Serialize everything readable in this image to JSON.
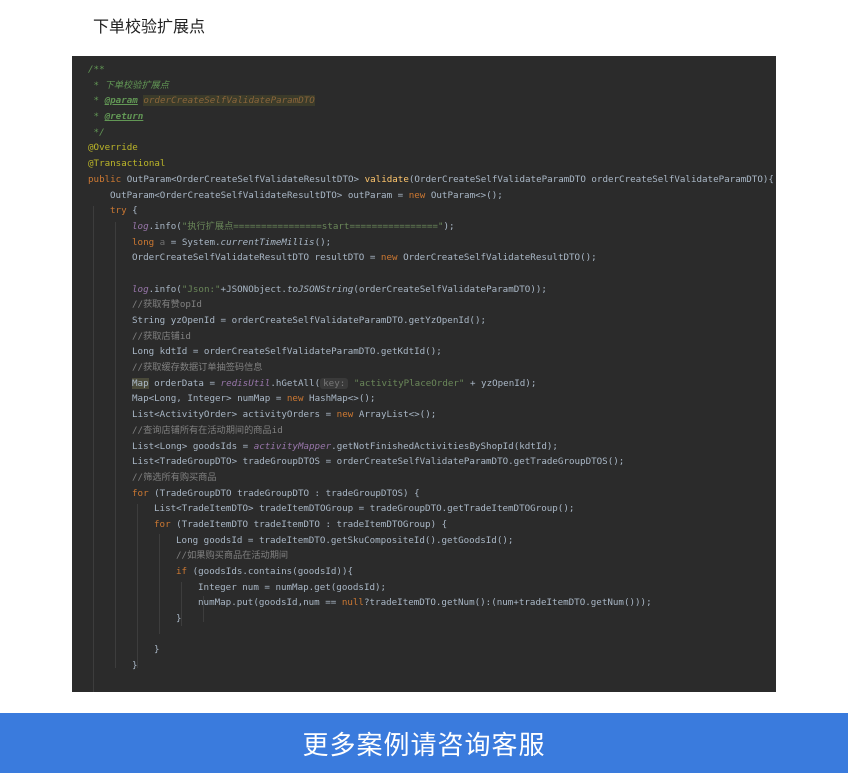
{
  "header": {
    "title": "下单校验扩展点"
  },
  "footer": {
    "text": "更多案例请咨询客服"
  },
  "colors": {
    "editor_bg": "#2b2b2b",
    "footer_bg": "#3a7bdd"
  },
  "code": {
    "l1": "/**",
    "l2": " * 下单校验扩展点",
    "l3_prefix": " * ",
    "l3_tag": "@param",
    "l3_name": "orderCreateSelfValidateParamDTO",
    "l4_prefix": " * ",
    "l4_tag": "@return",
    "l5": " */",
    "l6": "@Override",
    "l7": "@Transactional",
    "l8_kw": "public ",
    "l8_a": "OutParam<OrderCreateSelfValidateResultDTO> ",
    "l8_fn": "validate",
    "l8_b": "(OrderCreateSelfValidateParamDTO orderCreateSelfValidateParamDTO){",
    "l9_a": "OutParam<OrderCreateSelfValidateResultDTO> outParam = ",
    "l9_kw": "new ",
    "l9_b": "OutParam<>();",
    "l10_kw": "try ",
    "l10_b": "{",
    "l11_log": "log",
    "l11_a": ".info(",
    "l11_str": "\"执行扩展点================start================\"",
    "l11_b": ");",
    "l12_kw": "long ",
    "l12_var": "a",
    "l12_a": " = System.",
    "l12_it": "currentTimeMillis",
    "l12_b": "();",
    "l13_a": "OrderCreateSelfValidateResultDTO resultDTO = ",
    "l13_kw": "new ",
    "l13_b": "OrderCreateSelfValidateResultDTO();",
    "l15_log": "log",
    "l15_a": ".info(",
    "l15_str": "\"Json:\"",
    "l15_b": "+JSONObject.",
    "l15_it": "toJSONString",
    "l15_c": "(orderCreateSelfValidateParamDTO));",
    "l16": "//获取有赞opId",
    "l17": "String yzOpenId = orderCreateSelfValidateParamDTO.getYzOpenId();",
    "l18": "//获取店铺id",
    "l19": "Long kdtId = orderCreateSelfValidateParamDTO.getKdtId();",
    "l20": "//获取缓存数据订单抽签码信息",
    "l21_mark": "Map",
    "l21_a": " orderData = ",
    "l21_fld": "redisUtil",
    "l21_b": ".hGetAll(",
    "l21_hint": "key:",
    "l21_str": "\"activityPlaceOrder\"",
    "l21_c": " + yzOpenId);",
    "l22_a": "Map<Long, Integer> numMap = ",
    "l22_kw": "new ",
    "l22_b": "HashMap<>();",
    "l23_a": "List<ActivityOrder> activityOrders = ",
    "l23_kw": "new ",
    "l23_b": "ArrayList<>();",
    "l24": "//查询店铺所有在活动期间的商品id",
    "l25_a": "List<Long> goodsIds = ",
    "l25_fld": "activityMapper",
    "l25_b": ".getNotFinishedActivitiesByShopId(kdtId);",
    "l26": "List<TradeGroupDTO> tradeGroupDTOS = orderCreateSelfValidateParamDTO.getTradeGroupDTOS();",
    "l27": "//筛选所有购买商品",
    "l28_kw": "for ",
    "l28_a": "(TradeGroupDTO tradeGroupDTO : tradeGroupDTOS) {",
    "l29": "List<TradeItemDTO> tradeItemDTOGroup = tradeGroupDTO.getTradeItemDTOGroup();",
    "l30_kw": "for ",
    "l30_a": "(TradeItemDTO tradeItemDTO : tradeItemDTOGroup) {",
    "l31": "Long goodsId = tradeItemDTO.getSkuCompositeId().getGoodsId();",
    "l32": "//如果购买商品在活动期间",
    "l33_kw": "if ",
    "l33_a": "(goodsIds.contains(goodsId)){",
    "l34": "Integer num = numMap.get(goodsId);",
    "l35_a": "numMap.put(goodsId,num == ",
    "l35_kw": "null",
    "l35_b": "?tradeItemDTO.getNum():(num+tradeItemDTO.getNum()));",
    "l36": "}",
    "l38": "}",
    "l39": "}"
  }
}
